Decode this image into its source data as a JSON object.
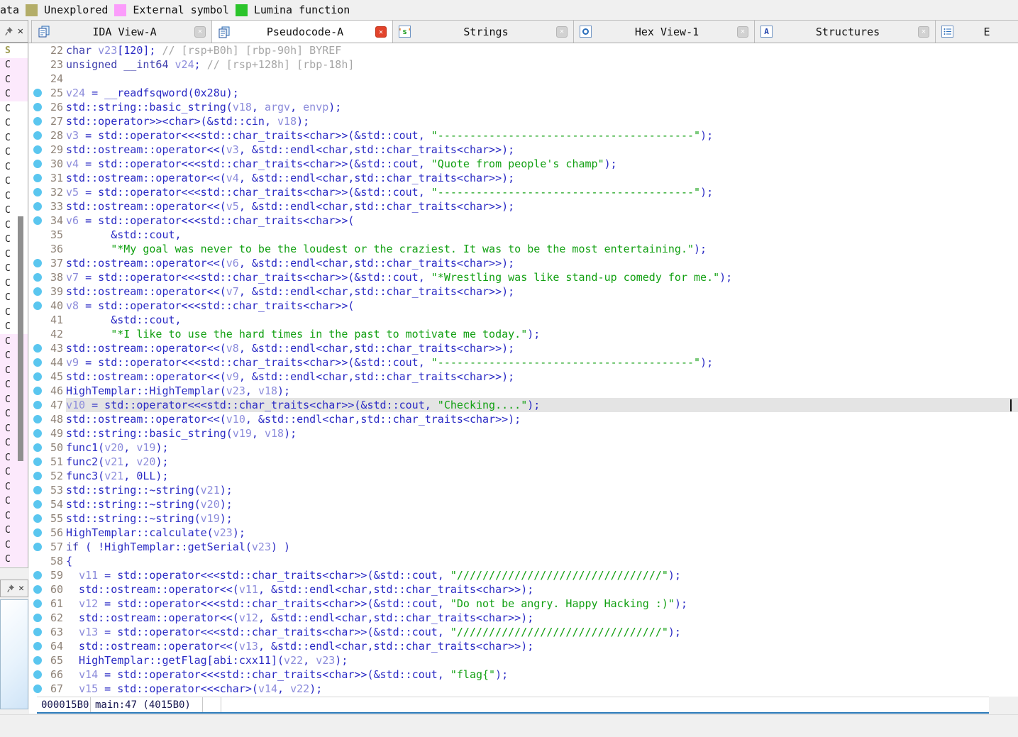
{
  "legend": {
    "partial_label": "ata",
    "items": [
      {
        "label": "Unexplored",
        "color": "#b3ad68"
      },
      {
        "label": "External symbol",
        "color": "#fb9cfb"
      },
      {
        "label": "Lumina function",
        "color": "#2bc42b"
      }
    ]
  },
  "tab_bar": {
    "tabs": [
      {
        "label": "IDA View-A",
        "icon": "ida-view-icon",
        "active": false,
        "close": "gray",
        "cut": false
      },
      {
        "label": "Pseudocode-A",
        "icon": "pseudocode-icon",
        "active": true,
        "close": "red",
        "cut": false
      },
      {
        "label": "Strings",
        "icon": "strings-icon",
        "active": false,
        "close": "gray",
        "cut": false
      },
      {
        "label": "Hex View-1",
        "icon": "hex-view-icon",
        "active": false,
        "close": "gray",
        "cut": false
      },
      {
        "label": "Structures",
        "icon": "structures-icon",
        "active": false,
        "close": "gray",
        "cut": false
      },
      {
        "label": "E",
        "icon": "enums-icon",
        "active": false,
        "close": "none",
        "cut": true
      }
    ]
  },
  "functions_panel": {
    "header_letter": "S",
    "row_letter": "C",
    "row_count": 35,
    "pink_rows": [
      0,
      1,
      2,
      19,
      20,
      21,
      22,
      23,
      24,
      25,
      26,
      27,
      28,
      29,
      30,
      31,
      32,
      33,
      34
    ]
  },
  "pseudocode": {
    "highlight_line": 47,
    "lines": [
      {
        "n": 22,
        "dot": false,
        "seg": [
          [
            "tk",
            "char "
          ],
          [
            "tv",
            "v23"
          ],
          [
            "td",
            "[120]; "
          ],
          [
            "tc",
            "// [rsp+B0h] [rbp-90h] BYREF"
          ]
        ]
      },
      {
        "n": 23,
        "dot": false,
        "seg": [
          [
            "tk",
            "unsigned __int64 "
          ],
          [
            "tv",
            "v24"
          ],
          [
            "td",
            "; "
          ],
          [
            "tc",
            "// [rsp+128h] [rbp-18h]"
          ]
        ]
      },
      {
        "n": 24,
        "dot": false,
        "seg": []
      },
      {
        "n": 25,
        "dot": true,
        "seg": [
          [
            "tv",
            "v24"
          ],
          [
            "td",
            " = __readfsqword(0x28u);"
          ]
        ]
      },
      {
        "n": 26,
        "dot": true,
        "seg": [
          [
            "td",
            "std::string::basic_string("
          ],
          [
            "tv",
            "v18"
          ],
          [
            "td",
            ", "
          ],
          [
            "tv",
            "argv"
          ],
          [
            "td",
            ", "
          ],
          [
            "tv",
            "envp"
          ],
          [
            "td",
            ");"
          ]
        ]
      },
      {
        "n": 27,
        "dot": true,
        "seg": [
          [
            "td",
            "std::operator>><char>(&std::cin, "
          ],
          [
            "tv",
            "v18"
          ],
          [
            "td",
            ");"
          ]
        ]
      },
      {
        "n": 28,
        "dot": true,
        "seg": [
          [
            "tv",
            "v3"
          ],
          [
            "td",
            " = std::operator<<<std::char_traits<char>>(&std::cout, "
          ],
          [
            "ts",
            "\"----------------------------------------\""
          ],
          [
            "td",
            ");"
          ]
        ]
      },
      {
        "n": 29,
        "dot": true,
        "seg": [
          [
            "td",
            "std::ostream::operator<<("
          ],
          [
            "tv",
            "v3"
          ],
          [
            "td",
            ", &std::endl<char,std::char_traits<char>>);"
          ]
        ]
      },
      {
        "n": 30,
        "dot": true,
        "seg": [
          [
            "tv",
            "v4"
          ],
          [
            "td",
            " = std::operator<<<std::char_traits<char>>(&std::cout, "
          ],
          [
            "ts",
            "\"Quote from people's champ\""
          ],
          [
            "td",
            ");"
          ]
        ]
      },
      {
        "n": 31,
        "dot": true,
        "seg": [
          [
            "td",
            "std::ostream::operator<<("
          ],
          [
            "tv",
            "v4"
          ],
          [
            "td",
            ", &std::endl<char,std::char_traits<char>>);"
          ]
        ]
      },
      {
        "n": 32,
        "dot": true,
        "seg": [
          [
            "tv",
            "v5"
          ],
          [
            "td",
            " = std::operator<<<std::char_traits<char>>(&std::cout, "
          ],
          [
            "ts",
            "\"----------------------------------------\""
          ],
          [
            "td",
            ");"
          ]
        ]
      },
      {
        "n": 33,
        "dot": true,
        "seg": [
          [
            "td",
            "std::ostream::operator<<("
          ],
          [
            "tv",
            "v5"
          ],
          [
            "td",
            ", &std::endl<char,std::char_traits<char>>);"
          ]
        ]
      },
      {
        "n": 34,
        "dot": true,
        "seg": [
          [
            "tv",
            "v6"
          ],
          [
            "td",
            " = std::operator<<<std::char_traits<char>>("
          ]
        ]
      },
      {
        "n": 35,
        "dot": false,
        "seg": [
          [
            "td",
            "       &std::cout,"
          ]
        ]
      },
      {
        "n": 36,
        "dot": false,
        "seg": [
          [
            "td",
            "       "
          ],
          [
            "ts",
            "\"*My goal was never to be the loudest or the craziest. It was to be the most entertaining.\""
          ],
          [
            "td",
            ");"
          ]
        ]
      },
      {
        "n": 37,
        "dot": true,
        "seg": [
          [
            "td",
            "std::ostream::operator<<("
          ],
          [
            "tv",
            "v6"
          ],
          [
            "td",
            ", &std::endl<char,std::char_traits<char>>);"
          ]
        ]
      },
      {
        "n": 38,
        "dot": true,
        "seg": [
          [
            "tv",
            "v7"
          ],
          [
            "td",
            " = std::operator<<<std::char_traits<char>>(&std::cout, "
          ],
          [
            "ts",
            "\"*Wrestling was like stand-up comedy for me.\""
          ],
          [
            "td",
            ");"
          ]
        ]
      },
      {
        "n": 39,
        "dot": true,
        "seg": [
          [
            "td",
            "std::ostream::operator<<("
          ],
          [
            "tv",
            "v7"
          ],
          [
            "td",
            ", &std::endl<char,std::char_traits<char>>);"
          ]
        ]
      },
      {
        "n": 40,
        "dot": true,
        "seg": [
          [
            "tv",
            "v8"
          ],
          [
            "td",
            " = std::operator<<<std::char_traits<char>>("
          ]
        ]
      },
      {
        "n": 41,
        "dot": false,
        "seg": [
          [
            "td",
            "       &std::cout,"
          ]
        ]
      },
      {
        "n": 42,
        "dot": false,
        "seg": [
          [
            "td",
            "       "
          ],
          [
            "ts",
            "\"*I like to use the hard times in the past to motivate me today.\""
          ],
          [
            "td",
            ");"
          ]
        ]
      },
      {
        "n": 43,
        "dot": true,
        "seg": [
          [
            "td",
            "std::ostream::operator<<("
          ],
          [
            "tv",
            "v8"
          ],
          [
            "td",
            ", &std::endl<char,std::char_traits<char>>);"
          ]
        ]
      },
      {
        "n": 44,
        "dot": true,
        "seg": [
          [
            "tv",
            "v9"
          ],
          [
            "td",
            " = std::operator<<<std::char_traits<char>>(&std::cout, "
          ],
          [
            "ts",
            "\"----------------------------------------\""
          ],
          [
            "td",
            ");"
          ]
        ]
      },
      {
        "n": 45,
        "dot": true,
        "seg": [
          [
            "td",
            "std::ostream::operator<<("
          ],
          [
            "tv",
            "v9"
          ],
          [
            "td",
            ", &std::endl<char,std::char_traits<char>>);"
          ]
        ]
      },
      {
        "n": 46,
        "dot": true,
        "seg": [
          [
            "td",
            "HighTemplar::HighTemplar("
          ],
          [
            "tv",
            "v23"
          ],
          [
            "td",
            ", "
          ],
          [
            "tv",
            "v18"
          ],
          [
            "td",
            ");"
          ]
        ]
      },
      {
        "n": 47,
        "dot": true,
        "seg": [
          [
            "tv",
            "v10"
          ],
          [
            "td",
            " = std::operator<<<std::char_traits<char>>(&std::cout, "
          ],
          [
            "ts",
            "\"Checking....\""
          ],
          [
            "td",
            ");"
          ]
        ]
      },
      {
        "n": 48,
        "dot": true,
        "seg": [
          [
            "td",
            "std::ostream::operator<<("
          ],
          [
            "tv",
            "v10"
          ],
          [
            "td",
            ", &std::endl<char,std::char_traits<char>>);"
          ]
        ]
      },
      {
        "n": 49,
        "dot": true,
        "seg": [
          [
            "td",
            "std::string::basic_string("
          ],
          [
            "tv",
            "v19"
          ],
          [
            "td",
            ", "
          ],
          [
            "tv",
            "v18"
          ],
          [
            "td",
            ");"
          ]
        ]
      },
      {
        "n": 50,
        "dot": true,
        "seg": [
          [
            "td",
            "func1("
          ],
          [
            "tv",
            "v20"
          ],
          [
            "td",
            ", "
          ],
          [
            "tv",
            "v19"
          ],
          [
            "td",
            ");"
          ]
        ]
      },
      {
        "n": 51,
        "dot": true,
        "seg": [
          [
            "td",
            "func2("
          ],
          [
            "tv",
            "v21"
          ],
          [
            "td",
            ", "
          ],
          [
            "tv",
            "v20"
          ],
          [
            "td",
            ");"
          ]
        ]
      },
      {
        "n": 52,
        "dot": true,
        "seg": [
          [
            "td",
            "func3("
          ],
          [
            "tv",
            "v21"
          ],
          [
            "td",
            ", 0LL);"
          ]
        ]
      },
      {
        "n": 53,
        "dot": true,
        "seg": [
          [
            "td",
            "std::string::~string("
          ],
          [
            "tv",
            "v21"
          ],
          [
            "td",
            ");"
          ]
        ]
      },
      {
        "n": 54,
        "dot": true,
        "seg": [
          [
            "td",
            "std::string::~string("
          ],
          [
            "tv",
            "v20"
          ],
          [
            "td",
            ");"
          ]
        ]
      },
      {
        "n": 55,
        "dot": true,
        "seg": [
          [
            "td",
            "std::string::~string("
          ],
          [
            "tv",
            "v19"
          ],
          [
            "td",
            ");"
          ]
        ]
      },
      {
        "n": 56,
        "dot": true,
        "seg": [
          [
            "td",
            "HighTemplar::calculate("
          ],
          [
            "tv",
            "v23"
          ],
          [
            "td",
            ");"
          ]
        ]
      },
      {
        "n": 57,
        "dot": true,
        "seg": [
          [
            "tk",
            "if"
          ],
          [
            "td",
            " ( !HighTemplar::getSerial("
          ],
          [
            "tv",
            "v23"
          ],
          [
            "td",
            ") )"
          ]
        ]
      },
      {
        "n": 58,
        "dot": false,
        "seg": [
          [
            "td",
            "{"
          ]
        ]
      },
      {
        "n": 59,
        "dot": true,
        "seg": [
          [
            "td",
            "  "
          ],
          [
            "tv",
            "v11"
          ],
          [
            "td",
            " = std::operator<<<std::char_traits<char>>(&std::cout, "
          ],
          [
            "ts",
            "\"////////////////////////////////\""
          ],
          [
            "td",
            ");"
          ]
        ]
      },
      {
        "n": 60,
        "dot": true,
        "seg": [
          [
            "td",
            "  std::ostream::operator<<("
          ],
          [
            "tv",
            "v11"
          ],
          [
            "td",
            ", &std::endl<char,std::char_traits<char>>);"
          ]
        ]
      },
      {
        "n": 61,
        "dot": true,
        "seg": [
          [
            "td",
            "  "
          ],
          [
            "tv",
            "v12"
          ],
          [
            "td",
            " = std::operator<<<std::char_traits<char>>(&std::cout, "
          ],
          [
            "ts",
            "\"Do not be angry. Happy Hacking :)\""
          ],
          [
            "td",
            ");"
          ]
        ]
      },
      {
        "n": 62,
        "dot": true,
        "seg": [
          [
            "td",
            "  std::ostream::operator<<("
          ],
          [
            "tv",
            "v12"
          ],
          [
            "td",
            ", &std::endl<char,std::char_traits<char>>);"
          ]
        ]
      },
      {
        "n": 63,
        "dot": true,
        "seg": [
          [
            "td",
            "  "
          ],
          [
            "tv",
            "v13"
          ],
          [
            "td",
            " = std::operator<<<std::char_traits<char>>(&std::cout, "
          ],
          [
            "ts",
            "\"////////////////////////////////\""
          ],
          [
            "td",
            ");"
          ]
        ]
      },
      {
        "n": 64,
        "dot": true,
        "seg": [
          [
            "td",
            "  std::ostream::operator<<("
          ],
          [
            "tv",
            "v13"
          ],
          [
            "td",
            ", &std::endl<char,std::char_traits<char>>);"
          ]
        ]
      },
      {
        "n": 65,
        "dot": true,
        "seg": [
          [
            "td",
            "  HighTemplar::getFlag[abi:cxx11]("
          ],
          [
            "tv",
            "v22"
          ],
          [
            "td",
            ", "
          ],
          [
            "tv",
            "v23"
          ],
          [
            "td",
            ");"
          ]
        ]
      },
      {
        "n": 66,
        "dot": true,
        "seg": [
          [
            "td",
            "  "
          ],
          [
            "tv",
            "v14"
          ],
          [
            "td",
            " = std::operator<<<std::char_traits<char>>(&std::cout, "
          ],
          [
            "ts",
            "\"flag{\""
          ],
          [
            "td",
            ");"
          ]
        ]
      },
      {
        "n": 67,
        "dot": true,
        "seg": [
          [
            "td",
            "  "
          ],
          [
            "tv",
            "v15"
          ],
          [
            "td",
            " = std::operator<<<char>("
          ],
          [
            "tv",
            "v14"
          ],
          [
            "td",
            ", "
          ],
          [
            "tv",
            "v22"
          ],
          [
            "td",
            ");"
          ]
        ]
      }
    ]
  },
  "status_bar": {
    "cells": [
      "000015B0",
      "main:47 (4015B0)",
      ""
    ]
  }
}
